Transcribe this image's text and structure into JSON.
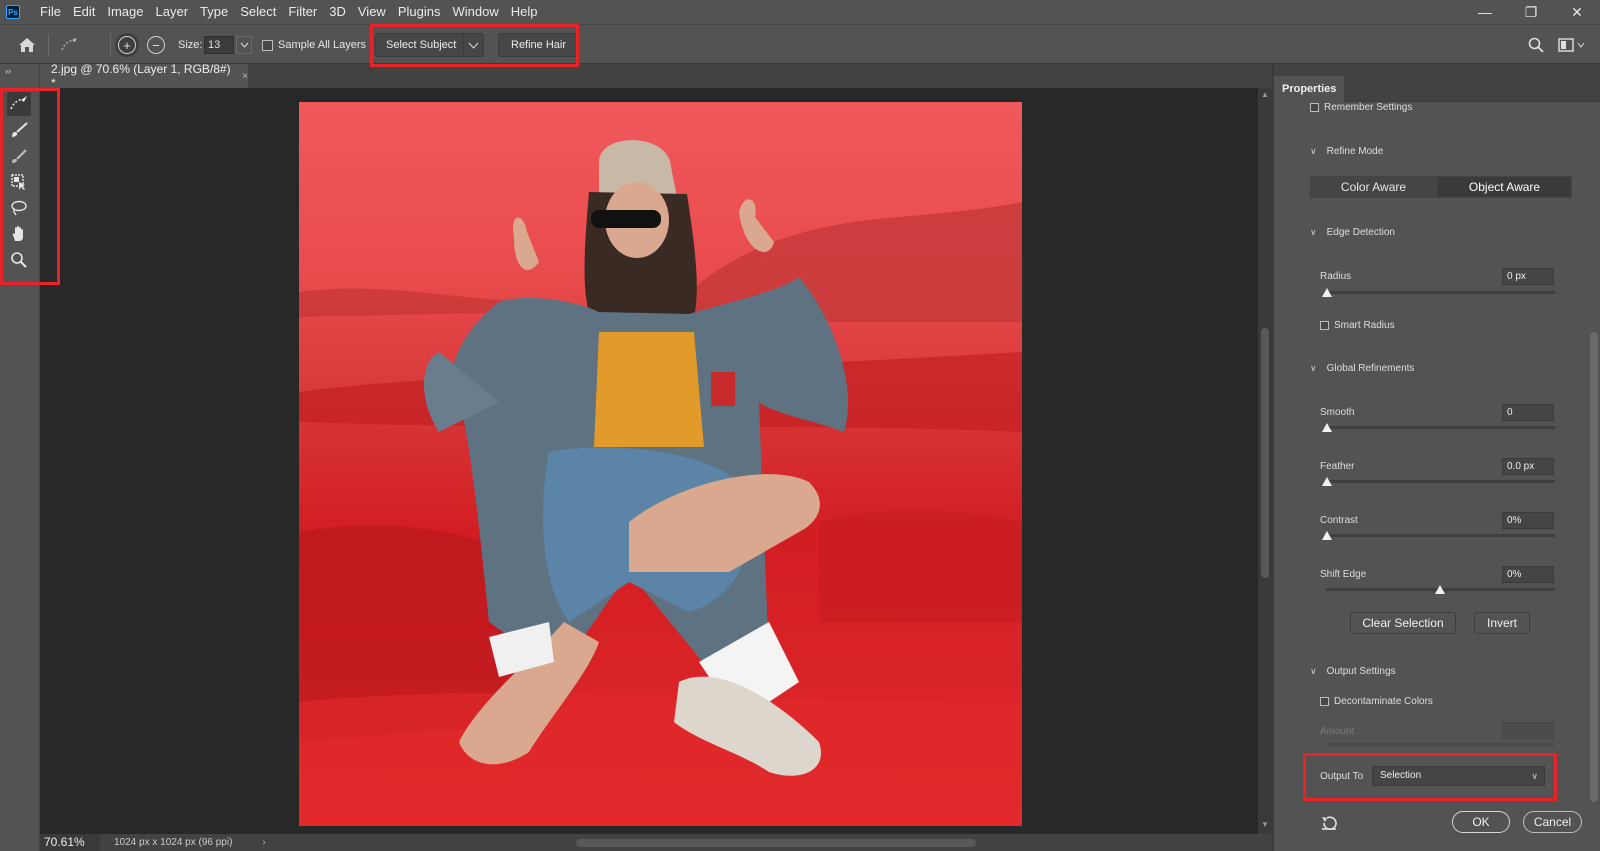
{
  "app": {
    "logo_text": "Ps"
  },
  "menu": [
    "File",
    "Edit",
    "Image",
    "Layer",
    "Type",
    "Select",
    "Filter",
    "3D",
    "View",
    "Plugins",
    "Window",
    "Help"
  ],
  "window_controls": {
    "minimize": "—",
    "maximize": "❐",
    "close": "✕"
  },
  "options_bar": {
    "size_label": "Size:",
    "size_value": "13",
    "sample_all_layers": "Sample All Layers",
    "select_subject": "Select Subject",
    "refine_hair": "Refine Hair",
    "add_symbol": "+",
    "subtract_symbol": "−"
  },
  "document": {
    "tab_title": "2.jpg @ 70.6% (Layer 1, RGB/8#) *",
    "close_symbol": "×"
  },
  "status": {
    "zoom": "70.61%",
    "doc_size": "1024 px x 1024 px (96 ppi)"
  },
  "properties": {
    "tab": "Properties",
    "remember_settings": "Remember Settings",
    "refine_mode": {
      "title": "Refine Mode",
      "options": [
        "Color Aware",
        "Object Aware"
      ],
      "selected": "Object Aware"
    },
    "edge_detection": {
      "title": "Edge Detection",
      "radius_label": "Radius",
      "radius_value": "0 px",
      "smart_radius": "Smart Radius"
    },
    "global_refinements": {
      "title": "Global Refinements",
      "smooth_label": "Smooth",
      "smooth_value": "0",
      "feather_label": "Feather",
      "feather_value": "0.0 px",
      "contrast_label": "Contrast",
      "contrast_value": "0%",
      "shift_edge_label": "Shift Edge",
      "shift_edge_value": "0%",
      "clear_selection": "Clear Selection",
      "invert": "Invert"
    },
    "output_settings": {
      "title": "Output Settings",
      "decontaminate": "Decontaminate Colors",
      "amount_label": "Amount",
      "output_to_label": "Output To",
      "output_to_value": "Selection"
    },
    "ok": "OK",
    "cancel": "Cancel"
  },
  "colors": {
    "highlight": "#e8242a",
    "overlay_red": "#e23a3a",
    "panel_bg": "#535353",
    "canvas_bg": "#282828"
  },
  "icons": {
    "home": "home-icon",
    "tools": [
      "quick-selection-icon",
      "refine-edge-brush-icon",
      "brush-icon",
      "object-selection-icon",
      "lasso-icon",
      "hand-icon",
      "zoom-icon"
    ]
  }
}
